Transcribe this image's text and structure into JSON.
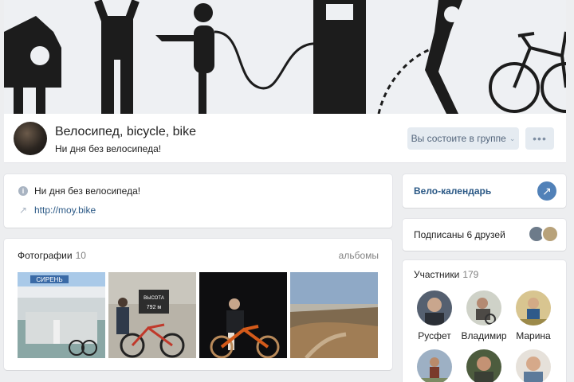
{
  "group": {
    "title": "Велосипед, bicycle, bike",
    "status": "Ни дня без велосипеда!",
    "member_button": "Вы состоите в группе",
    "more_label": "•••"
  },
  "info": {
    "description": "Ни дня без велосипеда!",
    "link": "http://moy.bike"
  },
  "photos": {
    "title": "Фотографии",
    "count": "10",
    "albums_link": "альбомы",
    "sign_top": "СИРЕНЬ",
    "sign_height_lines": [
      "ВЫСОТА",
      "792 м"
    ]
  },
  "sidebar": {
    "calendar_title": "Вело-календарь",
    "friends_text": "Подписаны 6 друзей",
    "members_title": "Участники",
    "members_count": "179",
    "members": [
      {
        "name": "Русфет"
      },
      {
        "name": "Владимир"
      },
      {
        "name": "Марина"
      },
      {
        "name": ""
      },
      {
        "name": ""
      },
      {
        "name": ""
      }
    ]
  },
  "colors": {
    "accent": "#5181b8",
    "link": "#2a5885",
    "page_bg": "#edeef0"
  },
  "icons": {
    "info": "info-icon",
    "link": "link-icon",
    "arrow": "arrow-up-right-icon",
    "chevron": "chevron-down-icon"
  }
}
